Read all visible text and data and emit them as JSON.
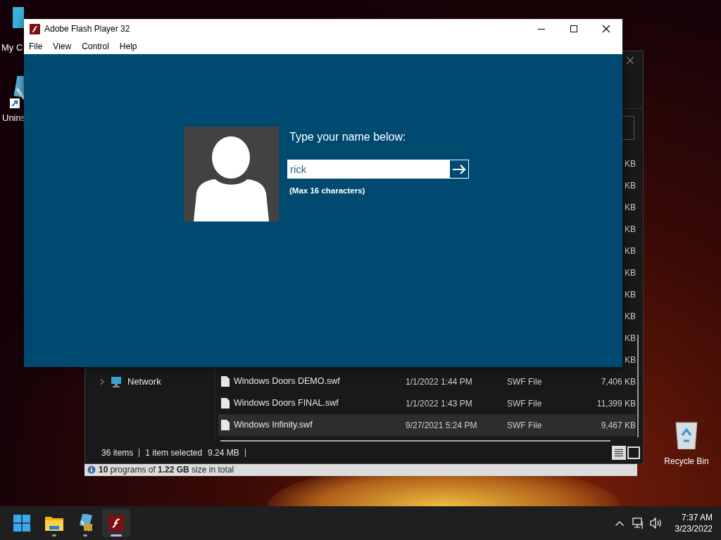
{
  "desktop_icons": [
    {
      "label": "My C",
      "kind": "computer"
    },
    {
      "label": "Unins",
      "kind": "installer"
    }
  ],
  "recycle_bin": {
    "label": "Recycle Bin"
  },
  "uninstaller": {
    "status": "**10** programs of **1.22 GB** size in total"
  },
  "explorer": {
    "nav": [
      {
        "label": "Network",
        "expanded": false
      }
    ],
    "files": [
      {
        "size": "KB",
        "selected": false
      },
      {
        "size": "KB",
        "selected": false
      },
      {
        "size": "KB",
        "selected": false
      },
      {
        "size": "KB",
        "selected": false
      },
      {
        "size": "KB",
        "selected": false
      },
      {
        "size": "KB",
        "selected": false
      },
      {
        "size": "KB",
        "selected": false
      },
      {
        "size": "KB",
        "selected": false
      },
      {
        "size": "KB",
        "selected": false
      },
      {
        "size": "KB",
        "selected": false
      },
      {
        "name": "Windows Doors DEMO.swf",
        "date": "1/1/2022 1:44 PM",
        "type": "SWF File",
        "size": "7,406 KB",
        "selected": false
      },
      {
        "name": "Windows Doors FINAL.swf",
        "date": "1/1/2022 1:43 PM",
        "type": "SWF File",
        "size": "11,399 KB",
        "selected": false
      },
      {
        "name": "Windows Infinity.swf",
        "date": "9/27/2021 5:24 PM",
        "type": "SWF File",
        "size": "9,467 KB",
        "selected": true
      }
    ],
    "status": [
      "36 items",
      "1 item selected",
      "9.24 MB"
    ]
  },
  "flash": {
    "title": "Adobe Flash Player 32",
    "menu": [
      "File",
      "View",
      "Control",
      "Help"
    ],
    "prompt": "Type your name below:",
    "name_value": "rick",
    "hint": "(Max 16 characters)"
  },
  "taskbar": {
    "apps": [
      {
        "kind": "explorer",
        "selected": false
      },
      {
        "kind": "installer",
        "selected": false
      },
      {
        "kind": "flash",
        "selected": true
      }
    ],
    "time": "7:37 AM",
    "date": "3/23/2022"
  }
}
